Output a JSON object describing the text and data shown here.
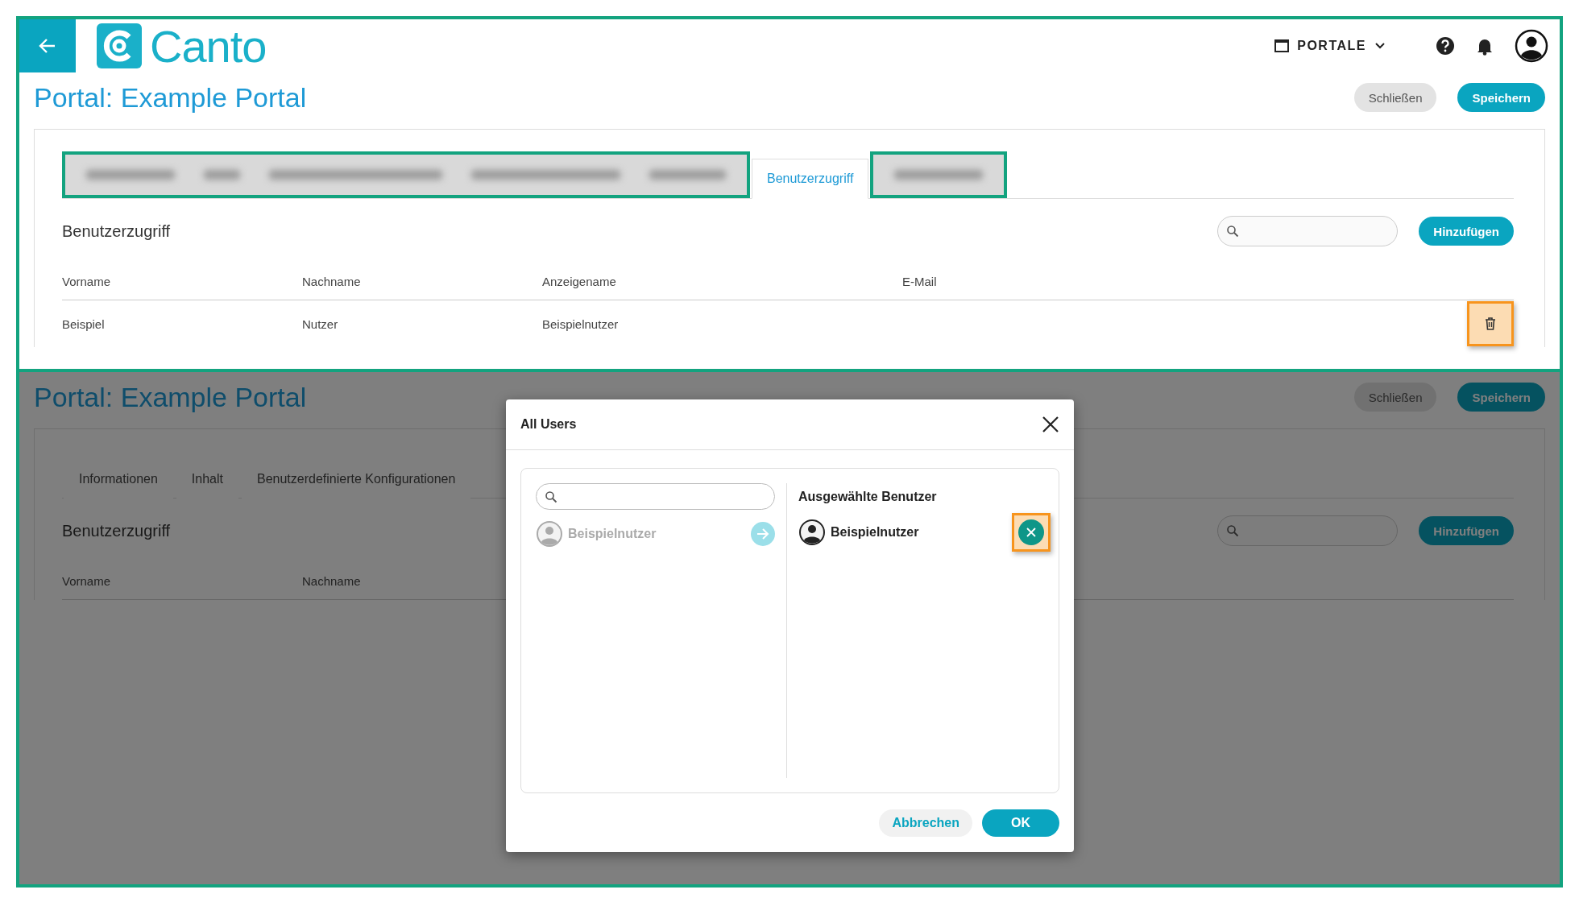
{
  "header": {
    "logo_text": "Canto",
    "portal_menu": "PORTALE"
  },
  "page_top": {
    "title": "Portal: Example Portal",
    "buttons": [
      {
        "kind": "secondary",
        "label": "Schließen"
      },
      {
        "kind": "primary",
        "label": "Speichern"
      }
    ],
    "tab_groups": [
      {
        "highlighted": true,
        "tabs": [
          {
            "kind": "blurred"
          },
          {
            "kind": "blurred"
          },
          {
            "kind": "blurred"
          },
          {
            "kind": "blurred"
          },
          {
            "kind": "blurred"
          }
        ]
      },
      {
        "highlighted": false,
        "tabs": [
          {
            "kind": "text",
            "label": "Benutzerzugriff",
            "selected": true
          }
        ]
      },
      {
        "highlighted": true,
        "tabs": [
          {
            "kind": "blurred"
          }
        ]
      }
    ],
    "section_title": "Benutzerzugriff",
    "add_button": "Hinzufügen",
    "columns": [
      "Vorname",
      "Nachname",
      "Anzeigename",
      "E-Mail"
    ],
    "rows": [
      {
        "cells": [
          "Beispiel",
          "Nutzer",
          "Beispielnutzer"
        ],
        "delete_highlighted": true
      }
    ]
  },
  "page_bottom": {
    "title": "Portal: Example Portal",
    "buttons": [
      {
        "kind": "secondary",
        "label": "Schließen"
      },
      {
        "kind": "primary",
        "label": "Speichern"
      }
    ],
    "tab_groups": [
      {
        "tabs": [
          {
            "kind": "text",
            "label": "Informationen",
            "selected": false
          },
          {
            "kind": "text",
            "label": "Inhalt",
            "selected": false
          },
          {
            "kind": "text",
            "label": "Benutzerdefinierte Konfigurationen",
            "selected": false
          }
        ]
      }
    ],
    "section_title": "Benutzerzugriff",
    "add_button": "Hinzufügen",
    "columns": [
      "Vorname",
      "Nachname"
    ]
  },
  "dialog": {
    "title": "All Users",
    "all_users": [
      {
        "name": "Beispielnutzer",
        "disabled": true
      }
    ],
    "selected_title": "Ausgewählte Benutzer",
    "selected_users": [
      {
        "name": "Beispielnutzer",
        "remove_highlighted": true
      }
    ],
    "cancel": "Abbrechen",
    "ok": "OK"
  }
}
